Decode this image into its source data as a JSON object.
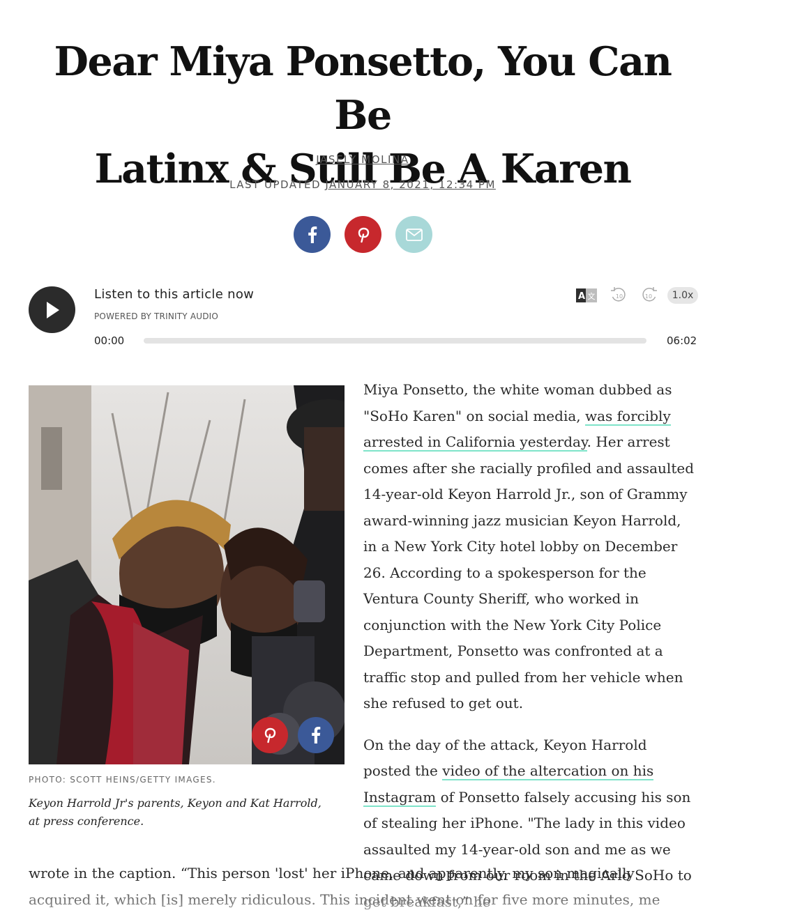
{
  "article": {
    "headline_line1": "Dear Miya Ponsetto, You Can Be",
    "headline_line2": "Latinx & Still Be A Karen",
    "author": "JASELY MOLINA",
    "updated_prefix": "LAST UPDATED",
    "updated_date": "JANUARY 8, 2021, 12:34 PM"
  },
  "share": {
    "facebook_icon": "facebook-icon",
    "pinterest_icon": "pinterest-icon",
    "email_icon": "email-icon",
    "colors": {
      "facebook": "#3b5998",
      "pinterest": "#c7282d",
      "email": "#a8d8d8"
    }
  },
  "audio": {
    "title": "Listen to this article now",
    "powered_by": "POWERED BY  TRINITY AUDIO",
    "current_time": "00:00",
    "duration": "06:02",
    "progress": 0,
    "speed": "1.0x",
    "back_label": "10",
    "fwd_label": "10"
  },
  "figure": {
    "credit": "PHOTO: SCOTT HEINS/GETTY IMAGES.",
    "caption": "Keyon Harrold Jr's parents, Keyon and Kat Harrold, at press conference."
  },
  "body": {
    "p1_a": "Miya Ponsetto, the white woman dubbed as \"SoHo Karen\" on social media, ",
    "p1_link": "was forcibly arrested in California yesterday",
    "p1_b": ". Her arrest comes after she racially profiled and assaulted 14-year-old Keyon Harrold Jr., son of Grammy award-winning jazz musician Keyon Harrold, in a New York City hotel lobby on December 26. According to a spokesperson for the Ventura County Sheriff, who worked in conjunction with the New York City Police Department, Ponsetto was confronted at a traffic stop and pulled from her vehicle when she refused to get out.",
    "p2_a": "On the day of the attack, Keyon Harrold posted the ",
    "p2_link": "video of the altercation on his Instagram",
    "p2_b": " of Ponsetto falsely accusing his son of stealing her iPhone. \"The lady in this video assaulted my 14-year-old son and me as we came down from our room in the Arlo SoHo to get breakfast,” he",
    "p2_c": "wrote in the caption. “This person 'lost' her iPhone, and apparently, my son magically acquired it, which [is] merely ridiculous. This incident went on for five more minutes, me protecting my"
  }
}
